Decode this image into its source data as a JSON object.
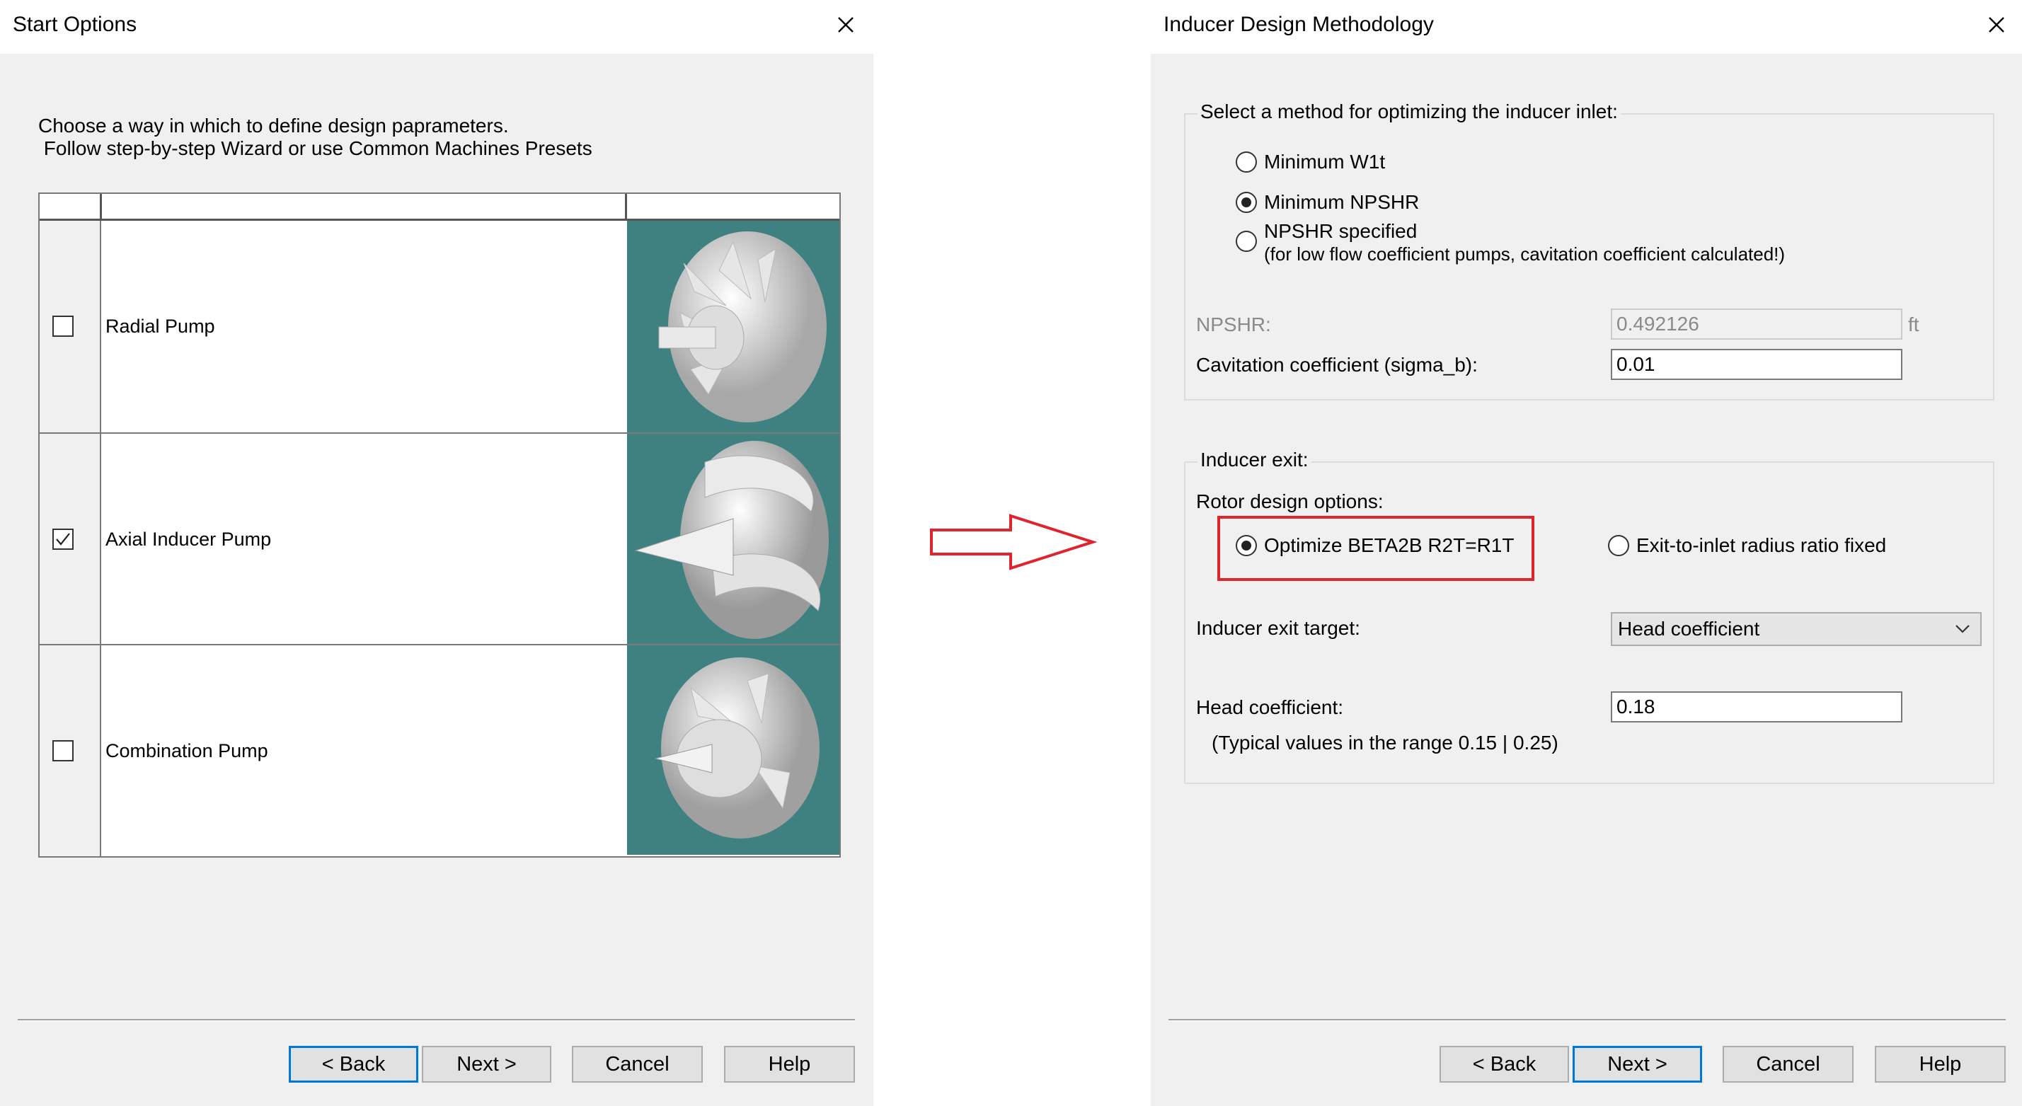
{
  "left": {
    "title": "Start Options",
    "intro": "Choose a way in which to define design paprameters.\n Follow step-by-step Wizard or use Common Machines Presets",
    "rows": [
      {
        "label": "Radial Pump",
        "checked": false,
        "icon": "radial-pump-image"
      },
      {
        "label": "Axial Inducer Pump",
        "checked": true,
        "icon": "axial-inducer-image"
      },
      {
        "label": "Combination Pump",
        "checked": false,
        "icon": "combination-pump-image"
      }
    ],
    "buttons": {
      "back": "< Back",
      "next": "Next >",
      "cancel": "Cancel",
      "help": "Help"
    }
  },
  "arrow": {
    "icon": "right-arrow-icon",
    "color": "#e0242e"
  },
  "right": {
    "title": "Inducer Design Methodology",
    "inlet_group": {
      "label": "Select a method for optimizing the inducer inlet:",
      "options": [
        {
          "label": "Minimum W1t",
          "selected": false
        },
        {
          "label": "Minimum NPSHR",
          "selected": true
        },
        {
          "label": "NPSHR specified",
          "sublabel": "(for low flow coefficient pumps, cavitation coefficient calculated!)",
          "selected": false
        }
      ],
      "npshr_label": "NPSHR:",
      "npshr_value": "0.492126",
      "npshr_unit": "ft",
      "cavitation_label": "Cavitation coefficient (sigma_b):",
      "cavitation_value": "0.01"
    },
    "exit_group": {
      "label": "Inducer exit:",
      "rotor_label": "Rotor design options:",
      "option_optimize": "Optimize BETA2B R2T=R1T",
      "option_fixed": "Exit-to-inlet radius ratio fixed",
      "optimize_selected": true,
      "target_label": "Inducer exit target:",
      "target_value": "Head coefficient",
      "head_label": "Head coefficient:",
      "head_value": "0.18",
      "typical_note": "(Typical values in the range 0.15 | 0.25)"
    },
    "highlight_color": "#e0242e",
    "buttons": {
      "back": "< Back",
      "next": "Next >",
      "cancel": "Cancel",
      "help": "Help"
    }
  }
}
